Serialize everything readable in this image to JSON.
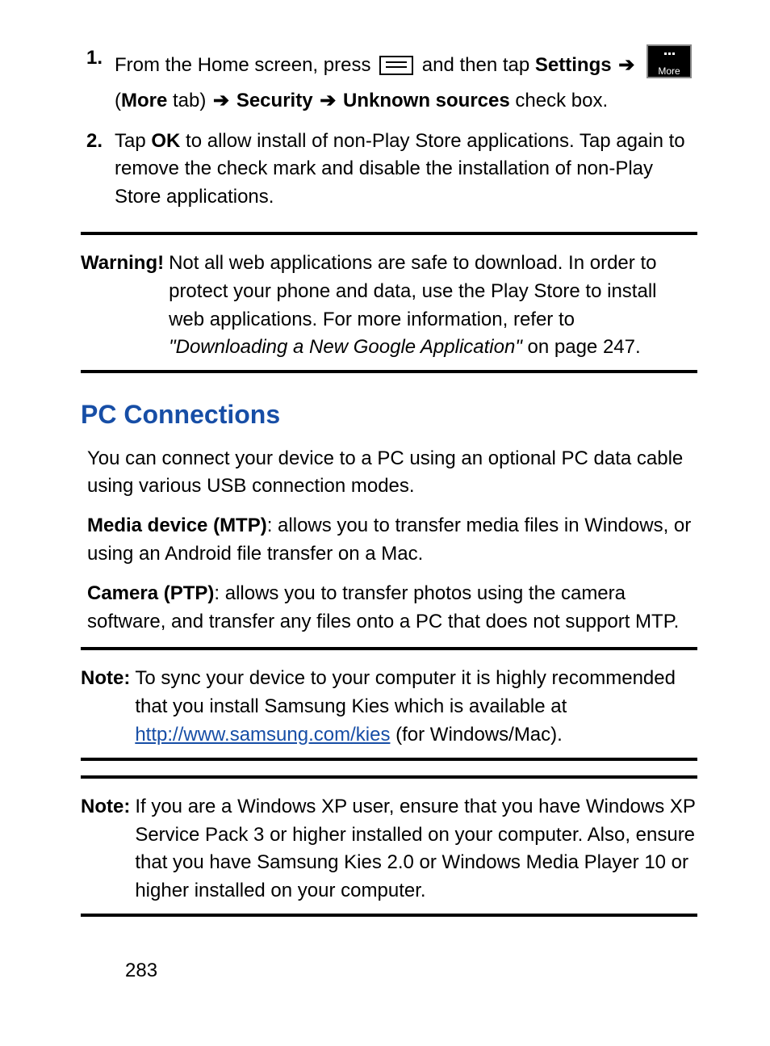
{
  "steps": [
    {
      "num": "1.",
      "prefix": "From the Home screen, press ",
      "afterMenu": " and then tap ",
      "settings": "Settings",
      "moreOpen": " (",
      "moreBold": "More",
      "moreTab": " tab) ",
      "security": "Security",
      "unknown": "Unknown sources",
      "suffix": " check box."
    },
    {
      "num": "2.",
      "tapPrefix": "Tap ",
      "ok": "OK",
      "tapSuffix": " to allow install of non-Play Store applications. Tap again to remove the check mark and disable the installation of non-Play Store applications."
    }
  ],
  "warning": {
    "label": "Warning!",
    "text1": "Not all web applications are safe to download. In order to protect your phone and data, use the Play Store to install web applications. For more information, refer to ",
    "refItalic": "\"Downloading a New Google Application\"",
    "text2": " on page 247."
  },
  "heading": "PC Connections",
  "intro": "You can connect your device to a PC using an optional PC data cable using various USB connection modes.",
  "mtp": {
    "label": "Media device (MTP)",
    "text": ": allows you to transfer media files in Windows, or using an Android file transfer on a Mac."
  },
  "ptp": {
    "label": "Camera (PTP)",
    "text": ": allows you to transfer photos using the camera software, and transfer any files onto a PC that does not support MTP."
  },
  "note1": {
    "label": "Note:",
    "text1": "To sync your device to your computer it is highly recommended that you install Samsung Kies which is available at ",
    "link": "http://www.samsung.com/kies",
    "text2": " (for Windows/Mac)."
  },
  "note2": {
    "label": "Note:",
    "text": "If you are a Windows XP user, ensure that you have Windows XP Service Pack 3 or higher installed on your computer. Also, ensure that you have Samsung Kies 2.0 or Windows Media Player 10 or higher installed on your computer."
  },
  "icons": {
    "moreLabel": "More"
  },
  "pageNumber": "283"
}
